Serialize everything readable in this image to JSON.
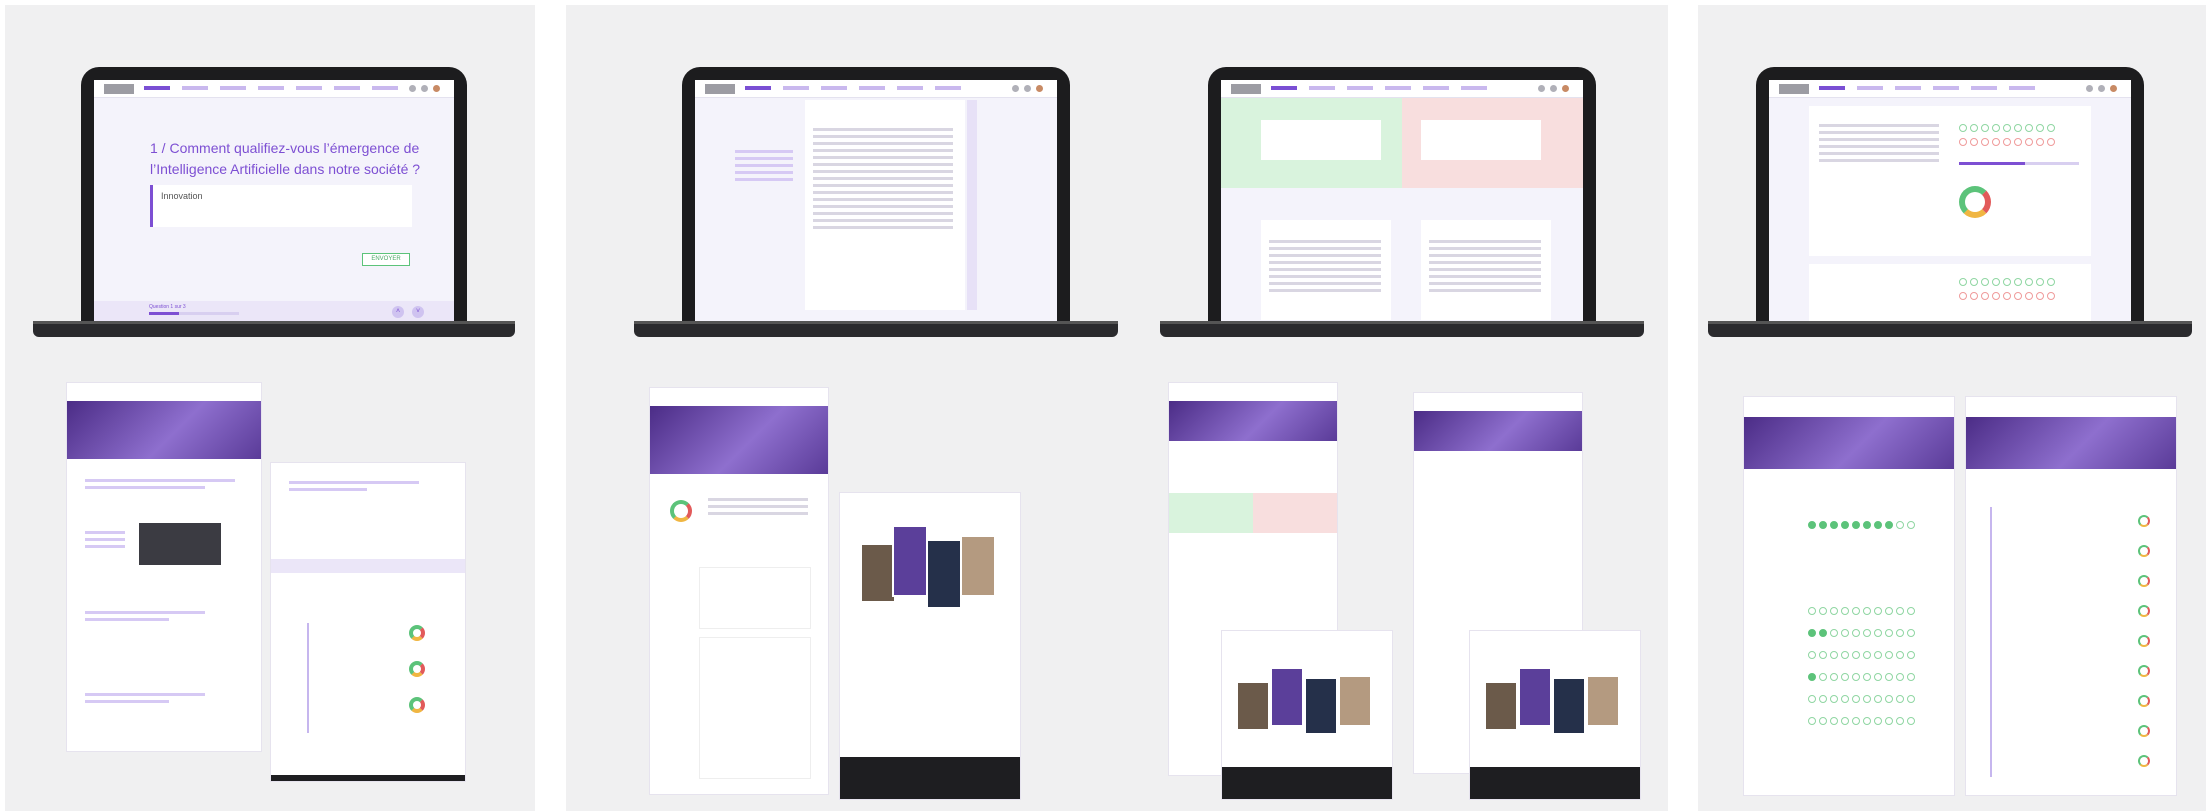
{
  "panel1": {
    "question": {
      "number": "1 /",
      "text_line1": "Comment qualifiez-vous l’émergence de",
      "text_line2": "l’Intelligence Artificielle dans notre société ?"
    },
    "answer": {
      "value": "Innovation"
    },
    "send_button": {
      "label": "ENVOYER"
    },
    "progress": {
      "label": "Question 1 sur 3",
      "fraction": 0.33
    }
  },
  "colors": {
    "accent": "#7d4fd3",
    "positive": "#5cc37a",
    "negative": "#e25a5a",
    "background": "#f0f0f1"
  },
  "icons": [
    "chevron-up-icon",
    "chevron-down-icon",
    "pencil-icon",
    "avatar-icon",
    "heart-icon"
  ]
}
